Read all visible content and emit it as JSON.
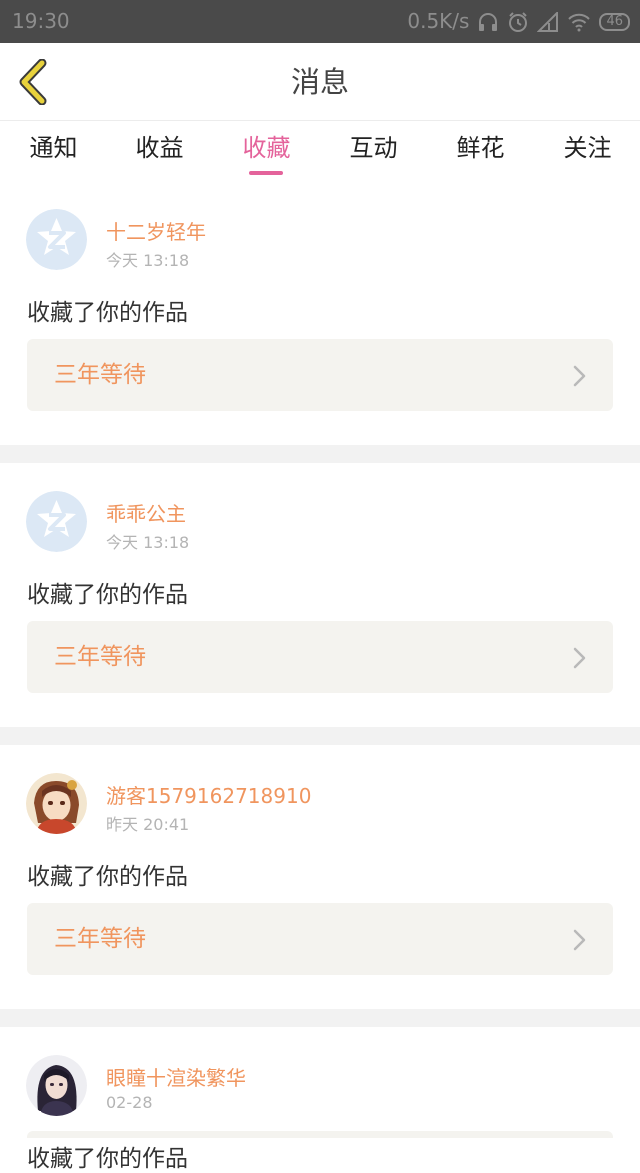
{
  "status_bar": {
    "time": "19:30",
    "speed": "0.5K/s",
    "battery": "46",
    "icons": [
      "headset-icon",
      "alarm-icon",
      "signal-icon",
      "wifi-icon",
      "battery-icon"
    ]
  },
  "header": {
    "title": "消息",
    "back_icon": "back-chevron-icon",
    "accent": "#e8d23c"
  },
  "tabs": [
    {
      "label": "通知"
    },
    {
      "label": "收益"
    },
    {
      "label": "收藏",
      "active": true
    },
    {
      "label": "互动"
    },
    {
      "label": "鲜花"
    },
    {
      "label": "关注"
    }
  ],
  "colors": {
    "accent_pink": "#e4639b",
    "name_orange": "#f0955e",
    "box_bg": "#f4f3ef"
  },
  "feed": [
    {
      "user": "十二岁轻年",
      "time": "今天 13:18",
      "action": "收藏了你的作品",
      "work": "三年等待",
      "avatar": "default-q-avatar"
    },
    {
      "user": "乖乖公主",
      "time": "今天 13:18",
      "action": "收藏了你的作品",
      "work": "三年等待",
      "avatar": "default-q-avatar"
    },
    {
      "user": "游客1579162718910",
      "time": "昨天 20:41",
      "action": "收藏了你的作品",
      "work": "三年等待",
      "avatar": "illustrated-girl-avatar"
    },
    {
      "user": "眼瞳十渲染繁华",
      "time": "02-28",
      "action": "收藏了你的作品",
      "avatar": "dark-hair-girl-avatar"
    }
  ]
}
